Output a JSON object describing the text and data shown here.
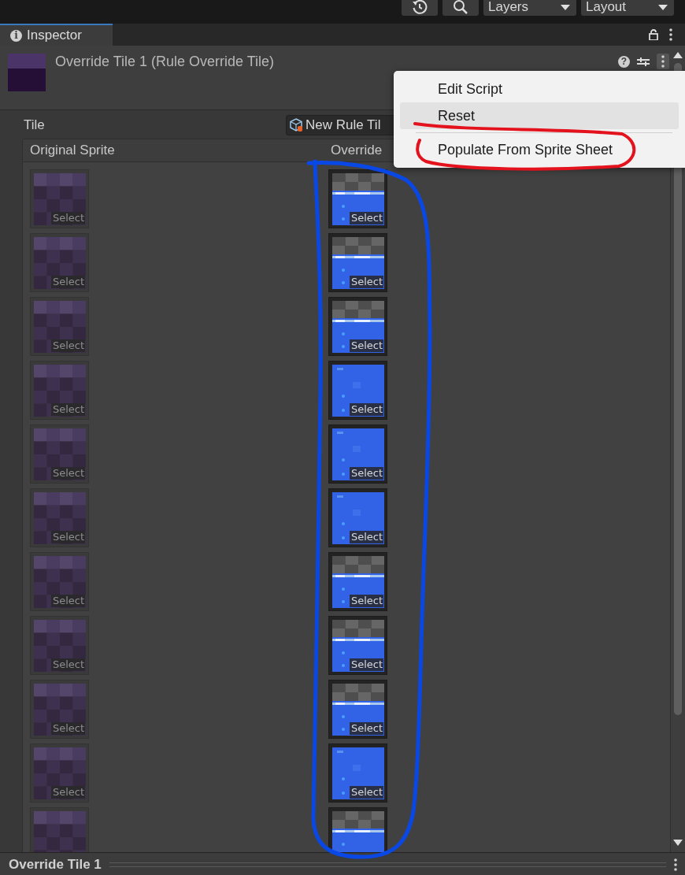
{
  "toolbar": {
    "dropdowns": [
      "Layers",
      "Layout"
    ]
  },
  "tab": {
    "info_icon": "i",
    "label": "Inspector",
    "selected": true
  },
  "header": {
    "title": "Override Tile 1 (Rule Override Tile)",
    "help_icon": "?"
  },
  "tile_field": {
    "label": "Tile",
    "value": "New Rule Til"
  },
  "columns": [
    "Original Sprite",
    "Override"
  ],
  "rows": [
    {
      "original": {
        "label": "Select"
      },
      "override": {
        "kind": "wall",
        "label": "Select"
      }
    },
    {
      "original": {
        "label": "Select"
      },
      "override": {
        "kind": "wall",
        "label": "Select"
      }
    },
    {
      "original": {
        "label": "Select"
      },
      "override": {
        "kind": "wall",
        "label": "Select"
      }
    },
    {
      "original": {
        "label": "Select"
      },
      "override": {
        "kind": "water",
        "label": "Select"
      }
    },
    {
      "original": {
        "label": "Select"
      },
      "override": {
        "kind": "water",
        "label": "Select"
      }
    },
    {
      "original": {
        "label": "Select"
      },
      "override": {
        "kind": "water",
        "label": "Select"
      }
    },
    {
      "original": {
        "label": "Select"
      },
      "override": {
        "kind": "wall",
        "label": "Select"
      }
    },
    {
      "original": {
        "label": "Select"
      },
      "override": {
        "kind": "wall",
        "label": "Select"
      }
    },
    {
      "original": {
        "label": "Select"
      },
      "override": {
        "kind": "wall",
        "label": "Select"
      }
    },
    {
      "original": {
        "label": "Select"
      },
      "override": {
        "kind": "water",
        "label": "Select"
      }
    },
    {
      "original": {},
      "override": {
        "kind": "wall"
      }
    }
  ],
  "context_menu": [
    {
      "label": "Edit Script",
      "highlighted": false
    },
    {
      "label": "Reset",
      "highlighted": true
    },
    {
      "label": "Populate From Sprite Sheet",
      "highlighted": false,
      "separator_before": true
    }
  ],
  "status_bar": {
    "title": "Override Tile 1"
  },
  "annotations": [
    {
      "color": "#e3121c"
    },
    {
      "color": "#0a48e6"
    }
  ]
}
